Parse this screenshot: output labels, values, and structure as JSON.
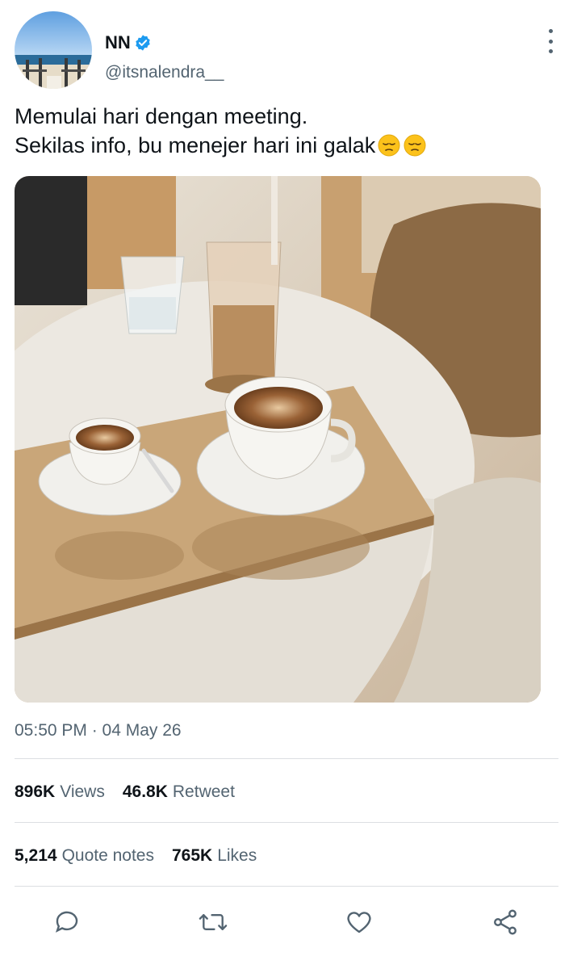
{
  "author": {
    "name": "NN",
    "handle": "@itsnalendra__",
    "verified": true,
    "avatar_icon": "beach-pier-avatar"
  },
  "tweet": {
    "line1": "Memulai hari dengan meeting.",
    "line2": "Sekilas info, bu menejer hari ini galak",
    "emojis": [
      "pensive-face-emoji",
      "pensive-face-emoji"
    ],
    "photo_icon": "coffee-cups-on-table-photo"
  },
  "meta": {
    "timestamp": "05:50 PM · 04 May 26"
  },
  "stats": {
    "views_num": "896K",
    "views_label": "Views",
    "retweet_num": "46.8K",
    "retweet_label": "Retweet",
    "quotes_num": "5,214",
    "quotes_label": "Quote notes",
    "likes_num": "765K",
    "likes_label": "Likes"
  },
  "actions": [
    "reply-icon",
    "retweet-icon",
    "like-icon",
    "share-icon"
  ],
  "colors": {
    "text": "#0f1419",
    "secondary": "#536471",
    "verified": "#1d9bf0",
    "divider": "#dcdfe2"
  }
}
